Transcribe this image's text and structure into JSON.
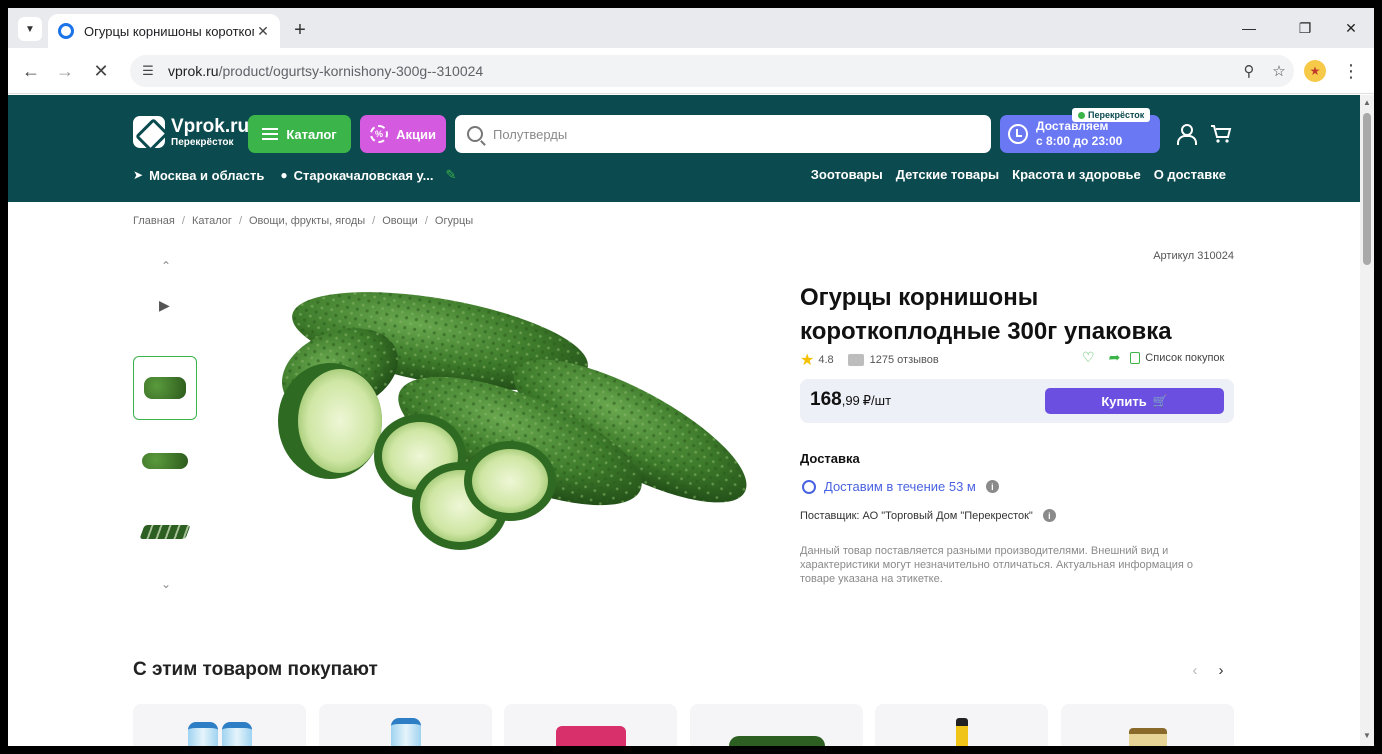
{
  "browser": {
    "tab_title": "Огурцы корнишоны короткоп",
    "url_host": "vprok.ru",
    "url_path": "/product/ogurtsy-kornishony-300g--310024"
  },
  "header": {
    "logo_main": "Vprok.ru",
    "logo_sub": "Перекрёсток",
    "catalog_label": "Каталог",
    "promo_label": "Акции",
    "search_placeholder": "Полутверды",
    "delivery_line1": "Доставляем",
    "delivery_line2": "с 8:00 до 23:00",
    "partner_badge": "Перекрёсток",
    "region": "Москва и область",
    "address": "Старокачаловская у...",
    "nav": [
      "Зоотовары",
      "Детские товары",
      "Красота и здоровье",
      "О доставке"
    ]
  },
  "breadcrumb": [
    "Главная",
    "Каталог",
    "Овощи, фрукты, ягоды",
    "Овощи",
    "Огурцы"
  ],
  "product": {
    "article": "Артикул 310024",
    "title": "Огурцы корнишоны короткоплодные 300г упаковка",
    "rating": "4.8",
    "reviews": "1275 отзывов",
    "shopping_list": "Список покупок",
    "price_int": "168",
    "price_frac": ",99",
    "price_unit": "₽/шт",
    "buy_label": "Купить",
    "delivery_title": "Доставка",
    "delivery_eta": "Доставим в течение 53 м",
    "supplier": "Поставщик: АО \"Торговый Дом \"Перекресток\"",
    "disclaimer": "Данный товар поставляется разными производителями. Внешний вид и характеристики могут незначительно отличаться. Актуальная информация о товаре указана на этикетке."
  },
  "also_bought": {
    "title": "С этим товаром покупают"
  },
  "colors": {
    "header_bg": "#0b4a4e",
    "catalog_green": "#3bb54a",
    "promo_pink": "#d45ae0",
    "delivery_blue": "#6a78f4",
    "buy_purple": "#6a4fe0"
  }
}
